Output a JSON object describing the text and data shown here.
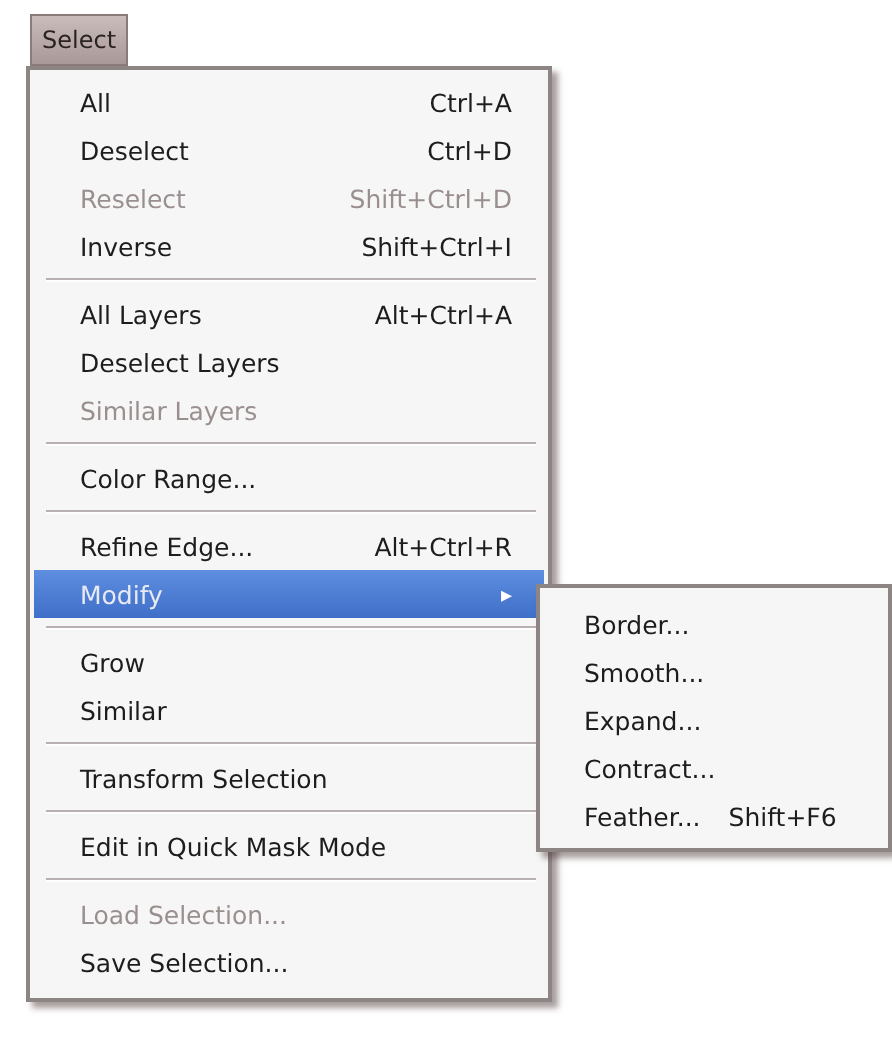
{
  "menu_title": "Select",
  "menu": {
    "groups": [
      {
        "items": [
          {
            "label": "All",
            "shortcut": "Ctrl+A",
            "disabled": false,
            "selected": false
          },
          {
            "label": "Deselect",
            "shortcut": "Ctrl+D",
            "disabled": false,
            "selected": false
          },
          {
            "label": "Reselect",
            "shortcut": "Shift+Ctrl+D",
            "disabled": true,
            "selected": false
          },
          {
            "label": "Inverse",
            "shortcut": "Shift+Ctrl+I",
            "disabled": false,
            "selected": false
          }
        ]
      },
      {
        "items": [
          {
            "label": "All Layers",
            "shortcut": "Alt+Ctrl+A",
            "disabled": false,
            "selected": false
          },
          {
            "label": "Deselect Layers",
            "disabled": false,
            "selected": false
          },
          {
            "label": "Similar Layers",
            "disabled": true,
            "selected": false
          }
        ]
      },
      {
        "items": [
          {
            "label": "Color Range...",
            "disabled": false,
            "selected": false
          }
        ]
      },
      {
        "items": [
          {
            "label": "Refine Edge...",
            "shortcut": "Alt+Ctrl+R",
            "disabled": false,
            "selected": false
          },
          {
            "label": "Modify",
            "submenu": "▸",
            "disabled": false,
            "selected": true
          }
        ]
      },
      {
        "items": [
          {
            "label": "Grow",
            "disabled": false,
            "selected": false
          },
          {
            "label": "Similar",
            "disabled": false,
            "selected": false
          }
        ]
      },
      {
        "items": [
          {
            "label": "Transform Selection",
            "disabled": false,
            "selected": false
          }
        ]
      },
      {
        "items": [
          {
            "label": "Edit in Quick Mask Mode",
            "disabled": false,
            "selected": false
          }
        ]
      },
      {
        "items": [
          {
            "label": "Load Selection...",
            "disabled": true,
            "selected": false
          },
          {
            "label": "Save Selection...",
            "disabled": false,
            "selected": false
          }
        ]
      }
    ]
  },
  "submenu": {
    "items": [
      {
        "label": "Border..."
      },
      {
        "label": "Smooth..."
      },
      {
        "label": "Expand..."
      },
      {
        "label": "Contract..."
      },
      {
        "label": "Feather...",
        "shortcut": "Shift+F6"
      }
    ]
  }
}
